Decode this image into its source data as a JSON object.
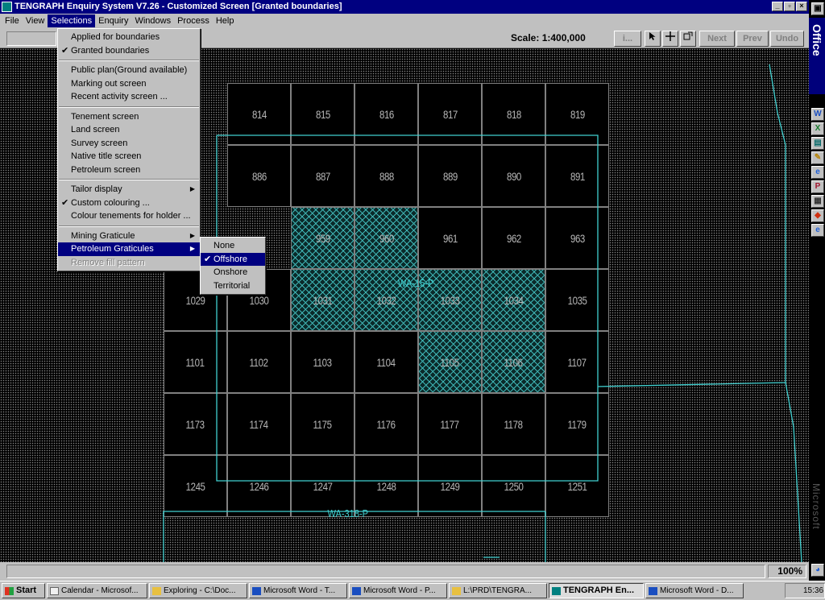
{
  "window": {
    "title": "TENGRAPH Enquiry System V7.26 - Customized Screen [Granted boundaries]"
  },
  "menubar": [
    "File",
    "View",
    "Selections",
    "Enquiry",
    "Windows",
    "Process",
    "Help"
  ],
  "toolbar": {
    "scale": "Scale: 1:400,000",
    "info_btn": "i...",
    "next": "Next",
    "prev": "Prev",
    "undo": "Undo"
  },
  "selections_menu": {
    "group1": [
      {
        "label": "Applied for boundaries",
        "checked": false
      },
      {
        "label": "Granted boundaries",
        "checked": true
      }
    ],
    "group2": [
      {
        "label": "Public plan(Ground available)"
      },
      {
        "label": "Marking out screen"
      },
      {
        "label": "Recent activity screen ..."
      }
    ],
    "group3": [
      {
        "label": "Tenement screen"
      },
      {
        "label": "Land screen"
      },
      {
        "label": "Survey screen"
      },
      {
        "label": "Native title screen"
      },
      {
        "label": "Petroleum screen"
      }
    ],
    "group4": [
      {
        "label": "Tailor display",
        "submenu": true
      },
      {
        "label": "Custom colouring ...",
        "checked": true
      },
      {
        "label": "Colour tenements for holder ..."
      }
    ],
    "group5": [
      {
        "label": "Mining Graticule",
        "submenu": true
      },
      {
        "label": "Petroleum Graticules",
        "submenu": true,
        "highlighted": true
      },
      {
        "label": "Remove fill pattern",
        "disabled": true
      }
    ]
  },
  "petroleum_submenu": [
    {
      "label": "None",
      "checked": false
    },
    {
      "label": "Offshore",
      "checked": true,
      "highlighted": true
    },
    {
      "label": "Onshore",
      "checked": false
    },
    {
      "label": "Territorial",
      "checked": false
    }
  ],
  "map": {
    "line_color": "#40d0d0",
    "grid_rows": [
      [
        "814",
        "815",
        "816",
        "817",
        "818",
        "819"
      ],
      [
        "886",
        "887",
        "888",
        "889",
        "890",
        "891"
      ],
      [
        "959",
        "960",
        "961",
        "962",
        "963"
      ],
      [
        "1029",
        "1030",
        "1031",
        "1032",
        "1033",
        "1034",
        "1035"
      ],
      [
        "1101",
        "1102",
        "1103",
        "1104",
        "1105",
        "1106",
        "1107"
      ],
      [
        "1173",
        "1174",
        "1175",
        "1176",
        "1177",
        "1178",
        "1179"
      ],
      [
        "1245",
        "1246",
        "1247",
        "1248",
        "1249",
        "1250",
        "1251"
      ]
    ],
    "labels": {
      "permit_a": "WA-15-P",
      "permit_b": "WA-318-P"
    },
    "hatched_blocks": [
      "959",
      "960",
      "1031",
      "1032",
      "1033",
      "1034",
      "1105",
      "1106"
    ]
  },
  "status": {
    "zoom": "100%"
  },
  "taskbar": {
    "start": "Start",
    "tasks": [
      "Calendar - Microsof...",
      "Exploring - C:\\Doc...",
      "Microsoft Word - T...",
      "Microsoft Word - P...",
      "L:\\PRD\\TENGRA...",
      "TENGRAPH En...",
      "Microsoft Word - D..."
    ],
    "active_task": "TENGRAPH En...",
    "clock": "15:36"
  },
  "office_bar": {
    "head": "Office",
    "foot": "Microsoft"
  }
}
